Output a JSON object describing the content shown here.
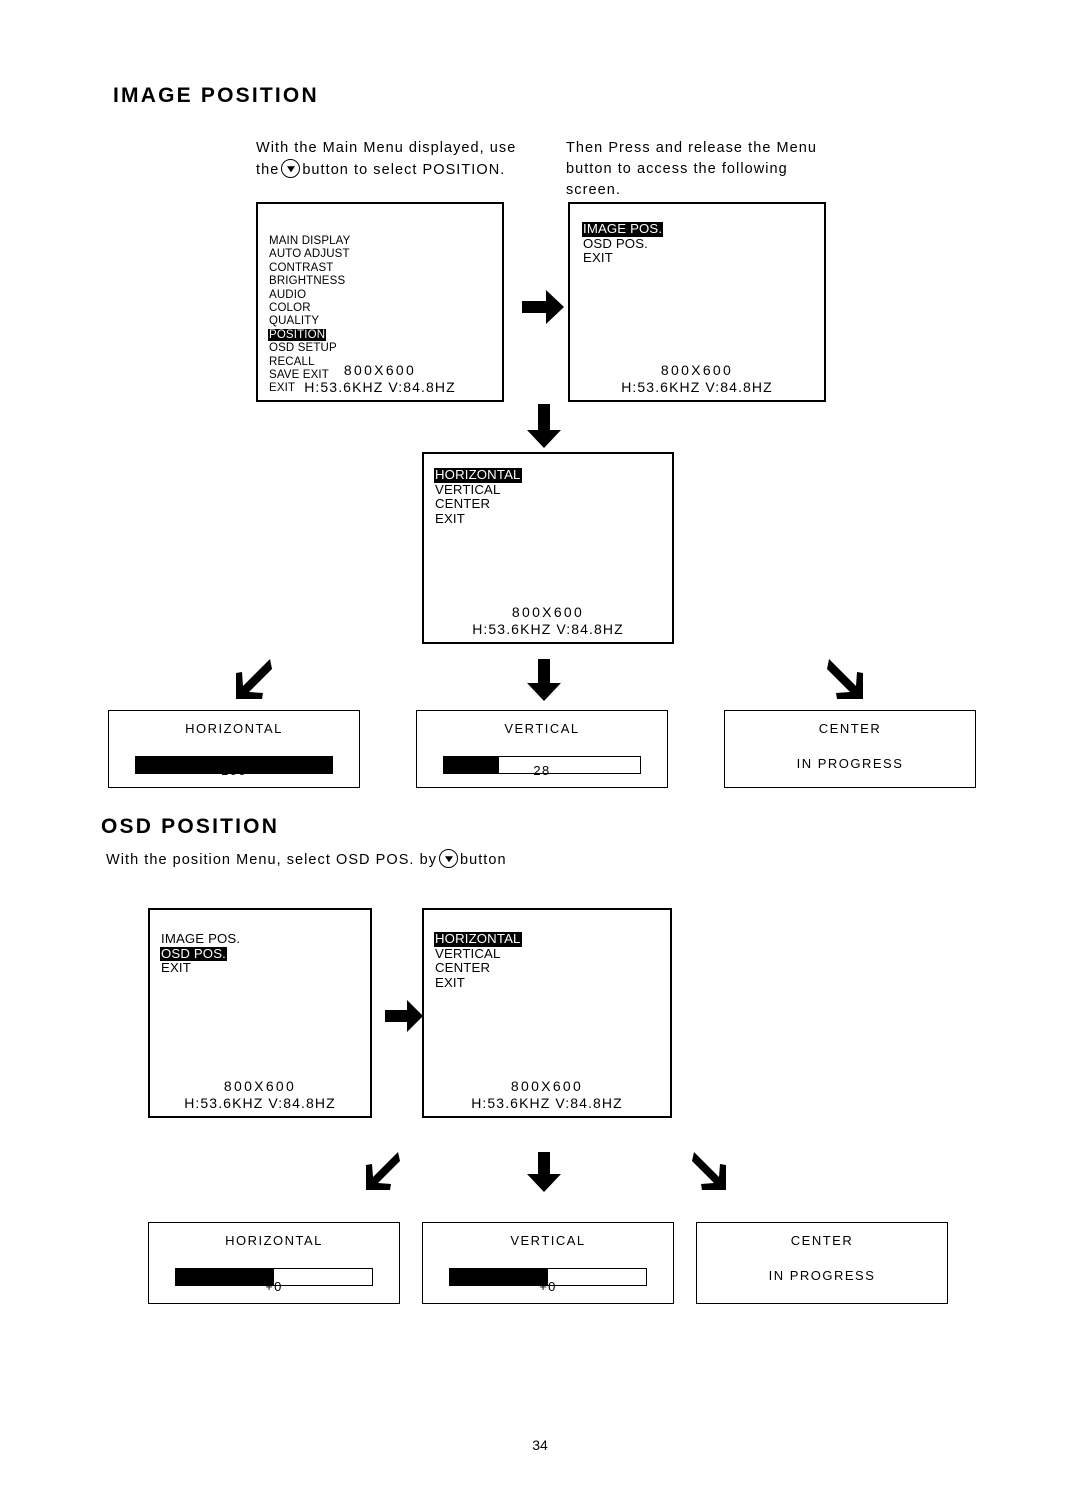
{
  "page": {
    "number": "34"
  },
  "sections": [
    {
      "heading": "IMAGE POSITION",
      "instructions": [
        {
          "line1": "With the Main Menu displayed, use",
          "line2_pre": "the",
          "line2_post": "button to select POSITION.",
          "has_button_glyph": true
        },
        {
          "line1": "Then Press and release the Menu",
          "line2": "button to access the following",
          "line3": "screen."
        }
      ]
    },
    {
      "heading": "OSD POSITION",
      "instruction": {
        "pre": "With the position Menu, select OSD POS. by",
        "post": "button",
        "has_button_glyph": true
      }
    }
  ],
  "screens": {
    "main_menu": {
      "items": [
        {
          "label": "MAIN DISPLAY",
          "selected": false
        },
        {
          "label": "AUTO ADJUST",
          "selected": false
        },
        {
          "label": "CONTRAST",
          "selected": false
        },
        {
          "label": "BRIGHTNESS",
          "selected": false
        },
        {
          "label": "AUDIO",
          "selected": false
        },
        {
          "label": "COLOR",
          "selected": false
        },
        {
          "label": "QUALITY",
          "selected": false
        },
        {
          "label": "POSITION",
          "selected": true
        },
        {
          "label": "OSD SETUP",
          "selected": false
        },
        {
          "label": "RECALL",
          "selected": false
        },
        {
          "label": "SAVE EXIT",
          "selected": false
        },
        {
          "label": "EXIT",
          "selected": false
        }
      ],
      "resolution": "800X600",
      "frequency": "H:53.6KHZ V:84.8HZ"
    },
    "position_menu_image": {
      "items": [
        {
          "label": "IMAGE POS.",
          "selected": true
        },
        {
          "label": "OSD POS.",
          "selected": false
        },
        {
          "label": "EXIT",
          "selected": false
        }
      ],
      "resolution": "800X600",
      "frequency": "H:53.6KHZ V:84.8HZ"
    },
    "image_pos_submenu": {
      "items": [
        {
          "label": "HORIZONTAL",
          "selected": true
        },
        {
          "label": "VERTICAL",
          "selected": false
        },
        {
          "label": "CENTER",
          "selected": false
        },
        {
          "label": "EXIT",
          "selected": false
        }
      ],
      "resolution": "800X600",
      "frequency": "H:53.6KHZ V:84.8HZ"
    },
    "position_menu_osd": {
      "items": [
        {
          "label": "IMAGE POS.",
          "selected": false
        },
        {
          "label": "OSD POS.",
          "selected": true
        },
        {
          "label": "EXIT",
          "selected": false
        }
      ],
      "resolution": "800X600",
      "frequency": "H:53.6KHZ V:84.8HZ"
    },
    "osd_pos_submenu": {
      "items": [
        {
          "label": "HORIZONTAL",
          "selected": true
        },
        {
          "label": "VERTICAL",
          "selected": false
        },
        {
          "label": "CENTER",
          "selected": false
        },
        {
          "label": "EXIT",
          "selected": false
        }
      ],
      "resolution": "800X600",
      "frequency": "H:53.6KHZ V:84.8HZ"
    }
  },
  "adjust_panels": {
    "image": [
      {
        "title": "HORIZONTAL",
        "value": "100",
        "fill_percent": 100,
        "type": "slider"
      },
      {
        "title": "VERTICAL",
        "value": "28",
        "fill_percent": 28,
        "type": "slider"
      },
      {
        "title": "CENTER",
        "status": "IN PROGRESS",
        "type": "status"
      }
    ],
    "osd": [
      {
        "title": "HORIZONTAL",
        "value": "+0",
        "fill_percent": 50,
        "type": "slider"
      },
      {
        "title": "VERTICAL",
        "value": "+0",
        "fill_percent": 50,
        "type": "slider"
      },
      {
        "title": "CENTER",
        "status": "IN PROGRESS",
        "type": "status"
      }
    ]
  },
  "arrows": {
    "right": "arrow-right-icon",
    "down": "arrow-down-icon",
    "down_left": "arrow-down-left-icon",
    "down_right": "arrow-down-right-icon"
  }
}
